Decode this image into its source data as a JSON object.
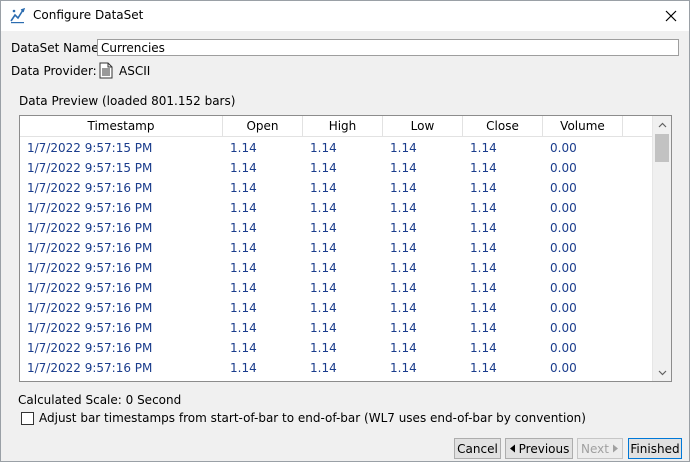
{
  "window": {
    "title": "Configure DataSet",
    "icons": {
      "app": "chart-sparkle-icon",
      "close": "close-icon"
    }
  },
  "dataset": {
    "name_label": "DataSet Name:",
    "name_value": "Currencies",
    "provider_label": "Data Provider:",
    "provider_value": "ASCII",
    "provider_icon": "document-icon"
  },
  "preview": {
    "label": "Data Preview (loaded 801.152 bars)",
    "columns": [
      "Timestamp",
      "Open",
      "High",
      "Low",
      "Close",
      "Volume"
    ],
    "rows": [
      [
        "1/7/2022 9:57:15 PM",
        "1.14",
        "1.14",
        "1.14",
        "1.14",
        "0.00"
      ],
      [
        "1/7/2022 9:57:15 PM",
        "1.14",
        "1.14",
        "1.14",
        "1.14",
        "0.00"
      ],
      [
        "1/7/2022 9:57:16 PM",
        "1.14",
        "1.14",
        "1.14",
        "1.14",
        "0.00"
      ],
      [
        "1/7/2022 9:57:16 PM",
        "1.14",
        "1.14",
        "1.14",
        "1.14",
        "0.00"
      ],
      [
        "1/7/2022 9:57:16 PM",
        "1.14",
        "1.14",
        "1.14",
        "1.14",
        "0.00"
      ],
      [
        "1/7/2022 9:57:16 PM",
        "1.14",
        "1.14",
        "1.14",
        "1.14",
        "0.00"
      ],
      [
        "1/7/2022 9:57:16 PM",
        "1.14",
        "1.14",
        "1.14",
        "1.14",
        "0.00"
      ],
      [
        "1/7/2022 9:57:16 PM",
        "1.14",
        "1.14",
        "1.14",
        "1.14",
        "0.00"
      ],
      [
        "1/7/2022 9:57:16 PM",
        "1.14",
        "1.14",
        "1.14",
        "1.14",
        "0.00"
      ],
      [
        "1/7/2022 9:57:16 PM",
        "1.14",
        "1.14",
        "1.14",
        "1.14",
        "0.00"
      ],
      [
        "1/7/2022 9:57:16 PM",
        "1.14",
        "1.14",
        "1.14",
        "1.14",
        "0.00"
      ],
      [
        "1/7/2022 9:57:16 PM",
        "1.14",
        "1.14",
        "1.14",
        "1.14",
        "0.00"
      ]
    ],
    "value_color": "#1a3c8c"
  },
  "scale_label": "Calculated Scale: 0 Second",
  "adjust_checkbox": {
    "label": "Adjust bar timestamps from start-of-bar to end-of-bar (WL7 uses end-of-bar by convention)",
    "checked": false
  },
  "buttons": {
    "cancel": "Cancel",
    "previous": "Previous",
    "next": "Next",
    "finished": "Finished"
  },
  "colors": {
    "accent": "#0078d7",
    "dialog_bg": "#f0f0f0"
  }
}
